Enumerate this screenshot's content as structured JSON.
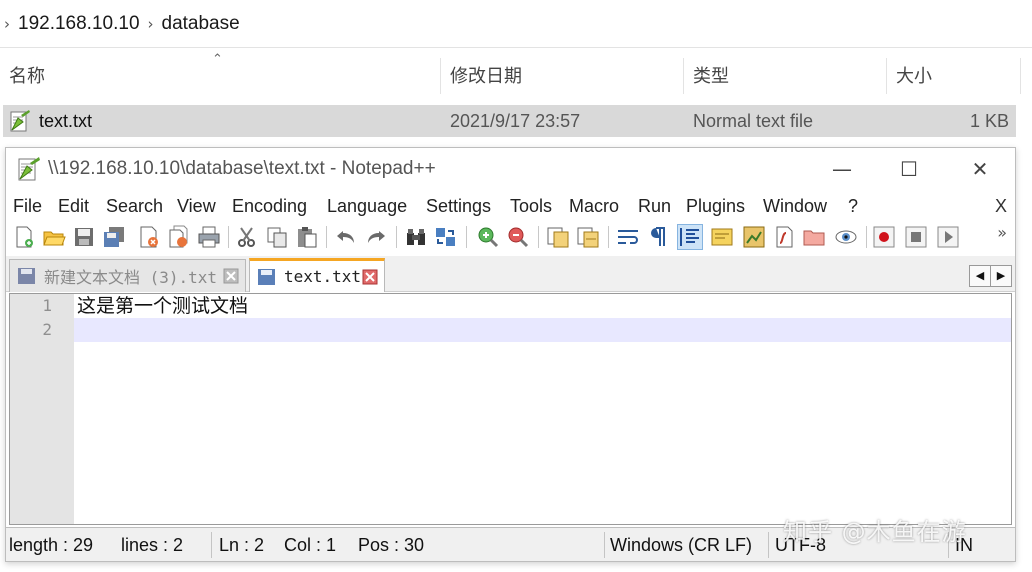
{
  "explorer": {
    "breadcrumb": [
      "192.168.10.10",
      "database"
    ],
    "columns": {
      "name": "名称",
      "modified": "修改日期",
      "type": "类型",
      "size": "大小"
    },
    "file": {
      "name": "text.txt",
      "modified": "2021/9/17 23:57",
      "type": "Normal text file",
      "size": "1 KB"
    }
  },
  "notepad": {
    "title": "\\\\192.168.10.10\\database\\text.txt - Notepad++",
    "window_buttons": {
      "minimize": "—",
      "maximize": "☐",
      "close": "✕"
    },
    "menu": [
      "File",
      "Edit",
      "Search",
      "View",
      "Encoding",
      "Language",
      "Settings",
      "Tools",
      "Macro",
      "Run",
      "Plugins",
      "Window",
      "?"
    ],
    "menu_close": "X",
    "toolbar_more": "»",
    "tabs": [
      {
        "label": "新建文本文档 (3).txt",
        "active": false
      },
      {
        "label": "text.txt",
        "active": true
      }
    ],
    "tab_nav": {
      "left": "◀",
      "right": "▶"
    },
    "editor": {
      "lines": [
        "这是第一个测试文档",
        ""
      ],
      "line_numbers": [
        "1",
        "2"
      ],
      "current_line": 2
    },
    "status": {
      "length": "length : 29",
      "lines": "lines : 2",
      "ln": "Ln : 2",
      "col": "Col : 1",
      "pos": "Pos : 30",
      "eol": "Windows (CR LF)",
      "encoding": "UTF-8",
      "mode": "IN"
    },
    "colors": {
      "active_tab_accent": "#f5a623",
      "current_line": "#e8e8ff",
      "gutter": "#e4e4e4"
    }
  },
  "watermark": "知乎 @木鱼在游"
}
